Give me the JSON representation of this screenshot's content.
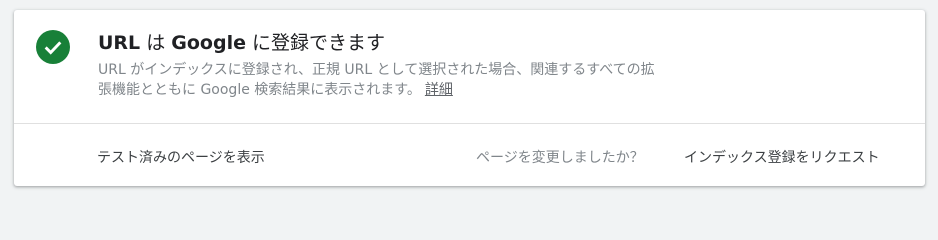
{
  "status": {
    "icon": "check-circle-icon",
    "color": "#188038"
  },
  "title": {
    "url_word": "URL",
    "is_word": "は",
    "google_word": "Google",
    "rest": "に登録できます"
  },
  "description": {
    "text": "URL がインデックスに登録され、正規 URL として選択された場合、関連するすべての拡張機能とともに Google 検索結果に表示されます。",
    "details_link": "詳細"
  },
  "actions": {
    "view_tested_page": "テスト済みのページを表示",
    "changed_question": "ページを変更しましたか？",
    "request_indexing": "インデックス登録をリクエスト"
  }
}
